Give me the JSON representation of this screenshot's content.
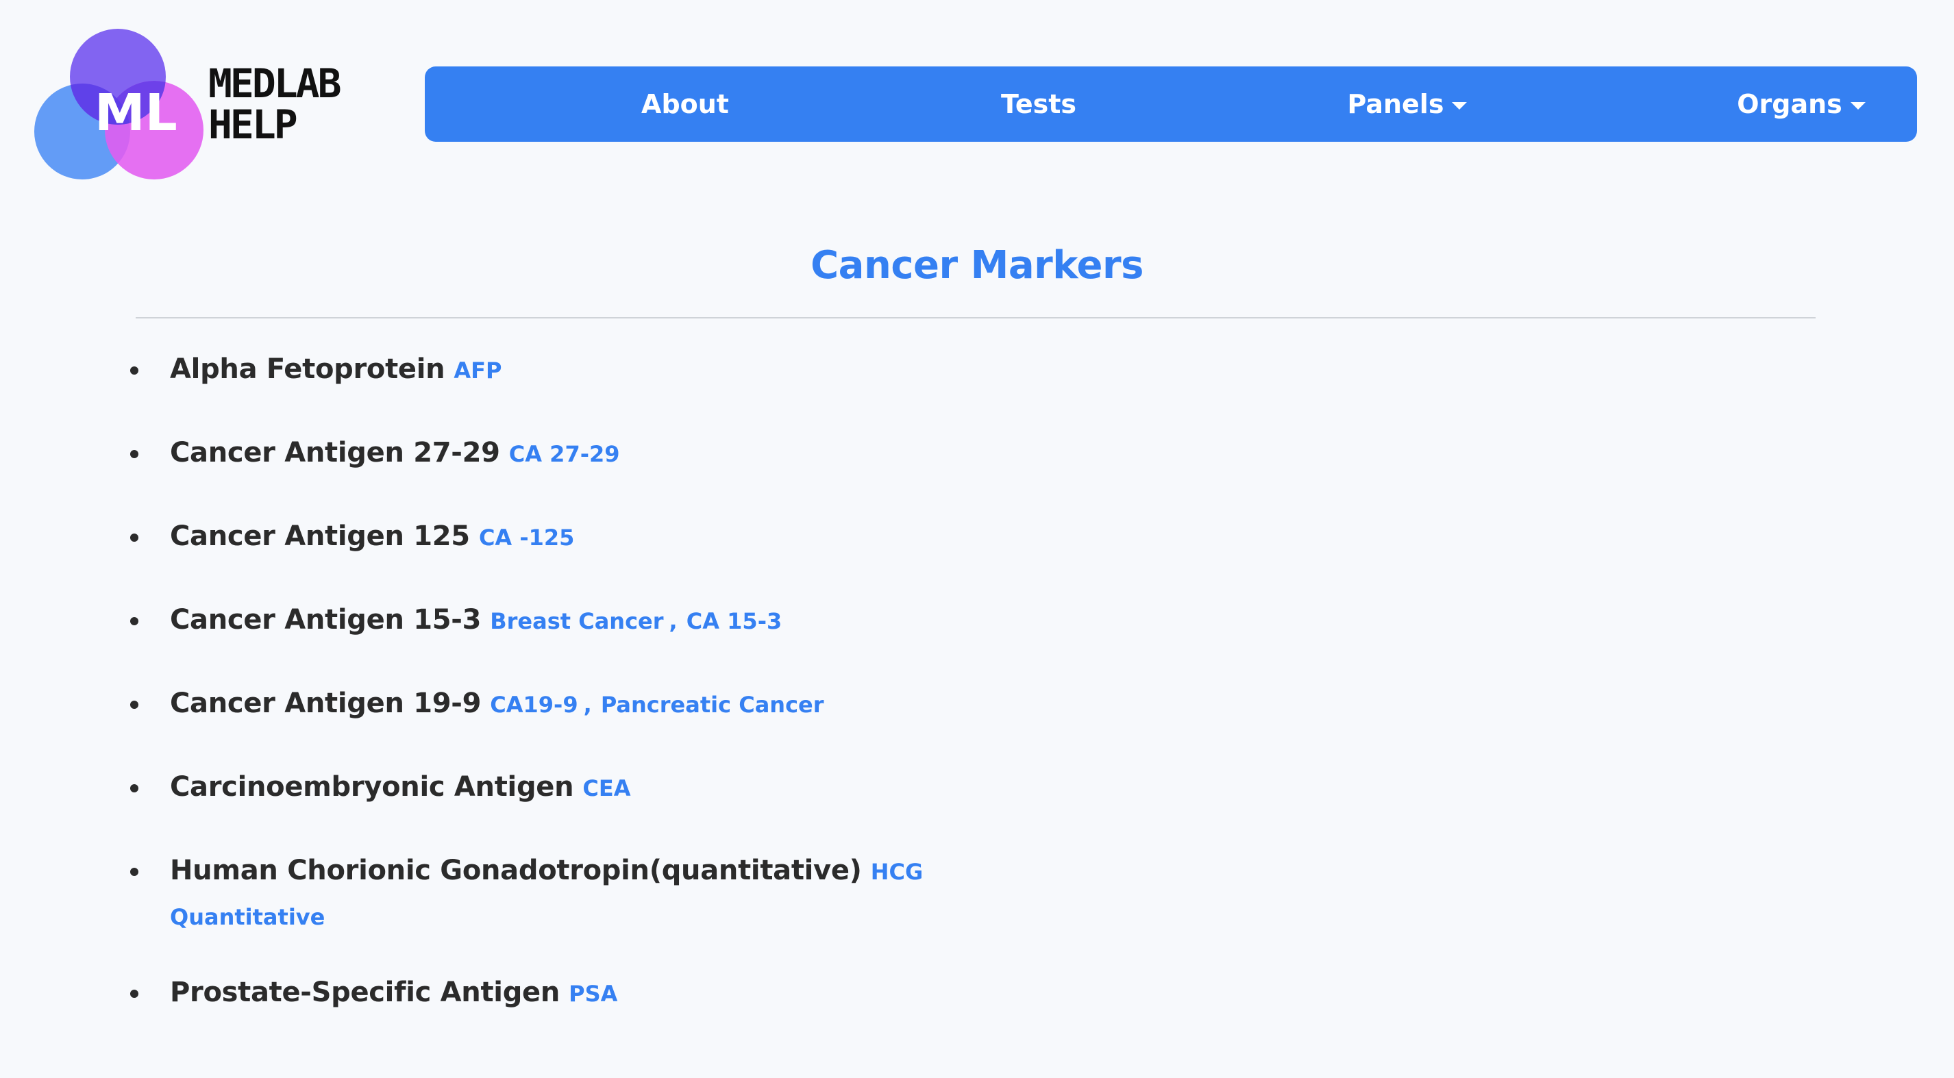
{
  "logo": {
    "monogram": "ML",
    "line1": "MEDLAB",
    "line2": "HELP",
    "colors": {
      "purple": "#7b5cf0",
      "blue": "#4f8ef5",
      "pink": "#e25cf0",
      "overlap": "#5a3ce8"
    }
  },
  "nav": {
    "about": "About",
    "tests": "Tests",
    "panels": "Panels",
    "organs": "Organs",
    "bg_color": "#3580f2"
  },
  "page": {
    "title": "Cancer Markers",
    "accent_color": "#3580f2"
  },
  "markers": [
    {
      "name": "Alpha Fetoprotein",
      "tags": [
        "AFP"
      ]
    },
    {
      "name": "Cancer Antigen 27-29",
      "tags": [
        "CA 27-29"
      ]
    },
    {
      "name": "Cancer Antigen 125",
      "tags": [
        "CA -125"
      ]
    },
    {
      "name": "Cancer Antigen 15-3",
      "tags": [
        "Breast Cancer",
        "CA 15-3"
      ]
    },
    {
      "name": "Cancer Antigen 19-9",
      "tags": [
        "CA19-9",
        "Pancreatic Cancer"
      ]
    },
    {
      "name": "Carcinoembryonic Antigen",
      "tags": [
        "CEA"
      ]
    },
    {
      "name": "Human Chorionic Gonadotropin(quantitative)",
      "tags": [
        "HCG",
        "Quantitative"
      ]
    },
    {
      "name": "Prostate-Specific Antigen",
      "tags": [
        "PSA"
      ]
    }
  ],
  "separator": ","
}
